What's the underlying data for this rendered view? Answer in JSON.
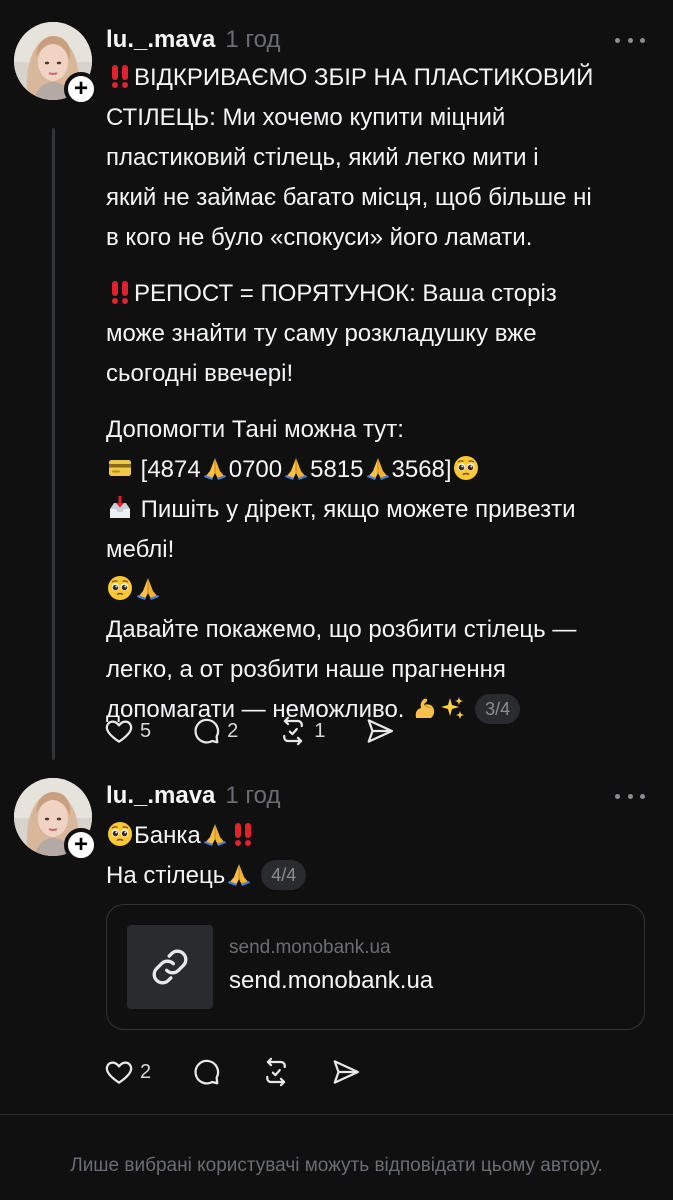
{
  "colors": {
    "background": "#101010",
    "text": "#f3f5f7",
    "muted": "#6a6d72",
    "divider": "#26282a"
  },
  "posts": [
    {
      "username": "lu._.mava",
      "time": "1 год",
      "avatar_icon": "avatar-photo",
      "follow_icon": "plus-icon",
      "follow_label": "+",
      "paragraphs": [
        {
          "lines": [
            [
              {
                "emoji": "double-exclamation"
              },
              {
                "text": "ВІДКРИВАЄМО ЗБІР НА ПЛАСТИКОВИЙ"
              }
            ],
            [
              {
                "text": "СТІЛЕЦЬ: Ми хочемо купити міцний"
              }
            ],
            [
              {
                "text": "пластиковий стілець, який легко мити і"
              }
            ],
            [
              {
                "text": "який не займає багато місця, щоб більше ні"
              }
            ],
            [
              {
                "text": "в кого не було «спокуси» його ламати."
              }
            ]
          ]
        },
        {
          "lines": [
            [
              {
                "emoji": "double-exclamation"
              },
              {
                "text": "РЕПОСТ = ПОРЯТУНОК: Ваша сторіз"
              }
            ],
            [
              {
                "text": "може знайти ту саму розкладушку вже"
              }
            ],
            [
              {
                "text": "сьогодні ввечері!"
              }
            ]
          ]
        },
        {
          "lines": [
            [
              {
                "text": "Допомогти Тані можна тут:"
              }
            ],
            [
              {
                "emoji": "credit-card"
              },
              {
                "text": " [4874"
              },
              {
                "emoji": "folded-hands"
              },
              {
                "text": "0700"
              },
              {
                "emoji": "folded-hands"
              },
              {
                "text": "5815"
              },
              {
                "emoji": "folded-hands"
              },
              {
                "text": "3568]"
              },
              {
                "emoji": "pleading-face"
              }
            ],
            [
              {
                "emoji": "inbox-tray"
              },
              {
                "text": " Пишіть у дірект, якщо можете привезти"
              }
            ],
            [
              {
                "text": "меблі!"
              }
            ],
            [
              {
                "emoji": "pleading-face"
              },
              {
                "emoji": "folded-hands"
              }
            ],
            [
              {
                "text": "Давайте покажемо, що розбити стілець —"
              }
            ],
            [
              {
                "text": "легко, а от розбити наше прагнення"
              }
            ],
            [
              {
                "text": "допомагати — неможливо. "
              },
              {
                "emoji": "flexed-biceps"
              },
              {
                "emoji": "sparkles"
              },
              {
                "counter": "3/4"
              }
            ]
          ]
        }
      ],
      "actions": [
        {
          "icon": "heart-icon",
          "count": "5"
        },
        {
          "icon": "comment-icon",
          "count": "2"
        },
        {
          "icon": "repost-icon",
          "count": "1"
        },
        {
          "icon": "share-icon",
          "count": ""
        }
      ]
    },
    {
      "username": "lu._.mava",
      "time": "1 год",
      "avatar_icon": "avatar-photo",
      "follow_icon": "plus-icon",
      "follow_label": "+",
      "paragraphs": [
        {
          "lines": [
            [
              {
                "emoji": "pleading-face"
              },
              {
                "text": "Банка"
              },
              {
                "emoji": "folded-hands"
              },
              {
                "emoji": "double-exclamation"
              }
            ],
            [
              {
                "text": "На стілець"
              },
              {
                "emoji": "folded-hands"
              },
              {
                "counter": "4/4"
              }
            ]
          ]
        }
      ],
      "link_card": {
        "domain": "send.monobank.ua",
        "title": "send.monobank.ua",
        "icon": "link-icon"
      },
      "actions": [
        {
          "icon": "heart-icon",
          "count": "2"
        },
        {
          "icon": "comment-icon",
          "count": ""
        },
        {
          "icon": "repost-icon",
          "count": ""
        },
        {
          "icon": "share-icon",
          "count": ""
        }
      ]
    }
  ],
  "footer": {
    "note": "Лише вибрані користувачі можуть відповідати цьому автору."
  }
}
